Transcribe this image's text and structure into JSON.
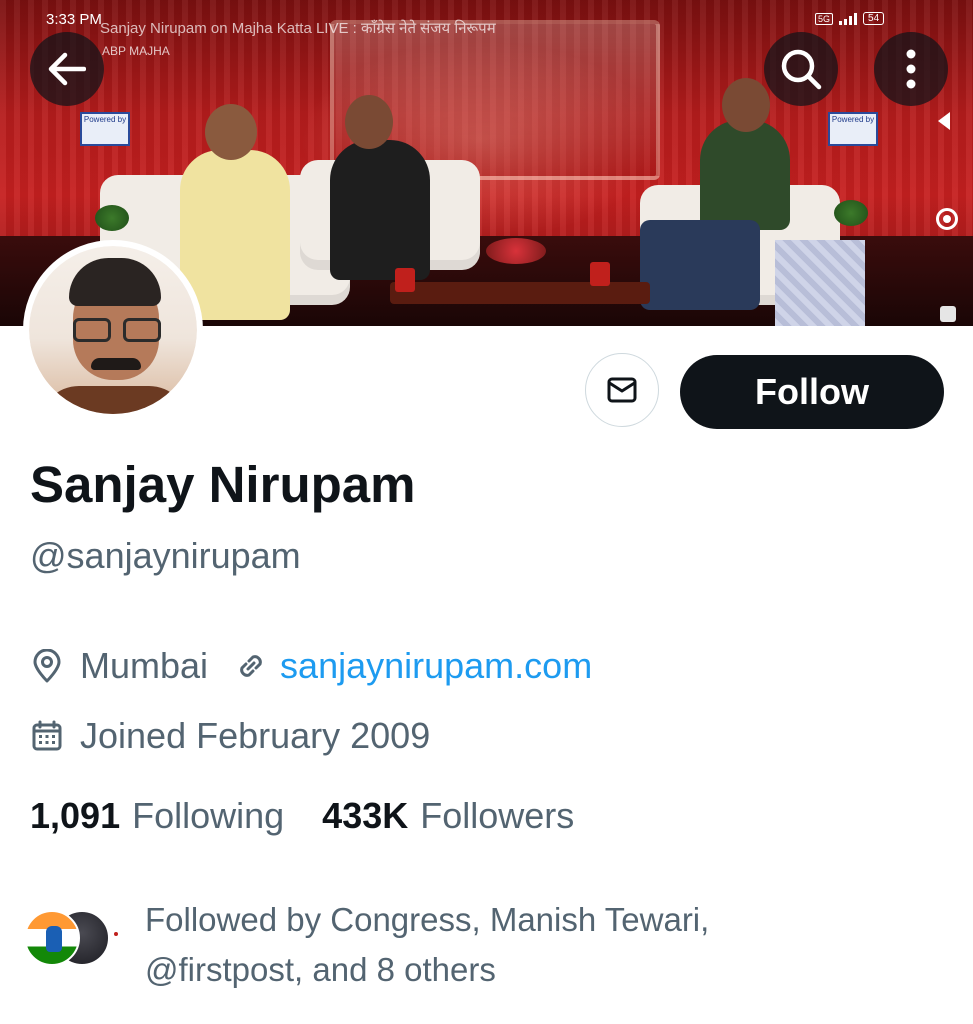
{
  "status_bar": {
    "time": "3:33 PM",
    "video_title": "Sanjay Nirupam on Majha Katta LIVE : काँग्रेस नेते संजय निरूपम",
    "channel": "ABP MAJHA",
    "network": "5G",
    "battery": "54"
  },
  "banner": {
    "sign_text": "Powered by"
  },
  "header": {
    "back_icon": "arrow-left-icon",
    "search_icon": "search-icon",
    "more_icon": "more-vertical-icon"
  },
  "actions": {
    "message_icon": "envelope-icon",
    "follow_label": "Follow"
  },
  "profile": {
    "display_name": "Sanjay Nirupam",
    "handle": "@sanjaynirupam",
    "location": "Mumbai",
    "website": "sanjaynirupam.com",
    "joined": "Joined February 2009"
  },
  "stats": {
    "following_count": "1,091",
    "following_label": "Following",
    "followers_count": "433K",
    "followers_label": "Followers"
  },
  "followed_by": {
    "text_line1": "Followed by Congress, Manish Tewari,",
    "text_line2": "@firstpost, and 8 others"
  },
  "colors": {
    "text_primary": "#0f1419",
    "text_secondary": "#536471",
    "link": "#1d9bf0",
    "follow_bg": "#0f1419"
  }
}
